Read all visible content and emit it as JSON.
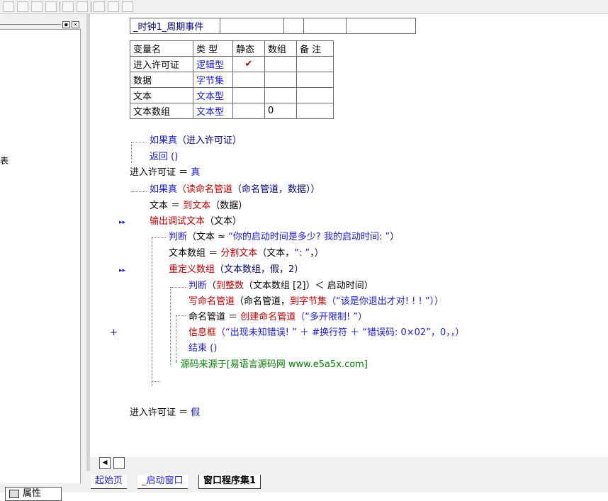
{
  "window": {
    "left_panel_stub": "表",
    "properties_tab": "属性"
  },
  "tabs": [
    "起始页",
    "_启动窗口",
    "窗口程序集1"
  ],
  "header_table": {
    "sub_name": "_时钟1_周期事件"
  },
  "var_table": {
    "headers": [
      "变量名",
      "类 型",
      "静态",
      "数组",
      "备 注"
    ],
    "rows": [
      {
        "name": "进入许可证",
        "type": "逻辑型",
        "static": "✔",
        "array": "",
        "note": ""
      },
      {
        "name": "数据",
        "type": "字节集",
        "static": "",
        "array": "",
        "note": ""
      },
      {
        "name": "文本",
        "type": "文本型",
        "static": "",
        "array": "",
        "note": ""
      },
      {
        "name": "文本数组",
        "type": "文本型",
        "static": "",
        "array": "0",
        "note": ""
      }
    ]
  },
  "code": {
    "l1_kw": "如果真",
    "l1_rest": "（进入许可证）",
    "l2": "返回 ()",
    "l3_a": "进入许可证 ＝ ",
    "l3_b": "真",
    "l4_kw": "如果真",
    "l4_fn": "读命名管道",
    "l4_rest": "（命名管道，数据））",
    "l4_open": "（",
    "l5_a": "文本 ＝ ",
    "l5_fn": "到文本",
    "l5_rest": "（数据）",
    "l6_fn": "输出调试文本",
    "l6_rest": "（文本）",
    "l7_kw": "判断",
    "l7_a": "（文本 ≈ ",
    "l7_str": "“你的启动时间是多少? 我的启动时间: ”",
    "l7_b": "）",
    "l8_a": "文本数组 ＝ ",
    "l8_fn": "分割文本",
    "l8_b": "（文本，",
    "l8_str": "“: ”",
    "l8_c": "，）",
    "l9_fn": "重定义数组",
    "l9_rest": "（文本数组，假，2）",
    "l10_kw": "判断",
    "l10_a": "（",
    "l10_fn": "到整数",
    "l10_b": "（文本数组 [2]）＜ 启动时间）",
    "l11_fn": "写命名管道",
    "l11_a": "（命名管道，",
    "l11_fn2": "到字节集",
    "l11_str": "（“该是你退出才对! ! ! ”））",
    "l12_a": "命名管道 ＝ ",
    "l12_fn": "创建命名管道",
    "l12_str": "（“多开限制! ”）",
    "l13_fn": "信息框",
    "l13_str": "（“出现未知错误! ” ＋ #换行符 ＋ “错误码: 0×02”，0，，）",
    "l14": "结束 ()",
    "l15": "' 源码来源于[易语言源码网 www.e5a5x.com]",
    "l16_a": "进入许可证 ＝ ",
    "l16_b": "假"
  },
  "markers": {
    "breakpoint": "▸▸",
    "plus": "+"
  }
}
